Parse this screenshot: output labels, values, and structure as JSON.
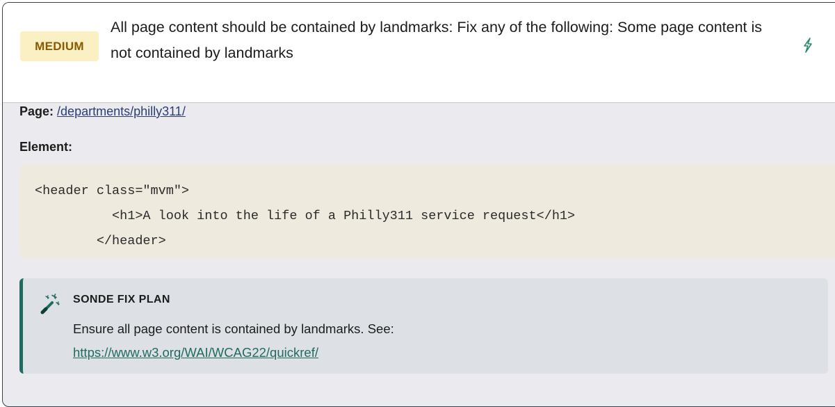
{
  "issue": {
    "severity": "MEDIUM",
    "title": "All page content should be contained by landmarks: Fix any of the following: Some page content is not contained by landmarks",
    "action_icon": "lightning-bolt-icon"
  },
  "details": {
    "page_label": "Page:",
    "page_link": "/departments/philly311/",
    "element_label": "Element:",
    "code_lines": [
      "<header class=\"mvm\">",
      "          <h1>A look into the life of a Philly311 service request</h1>",
      "        </header>"
    ]
  },
  "fix_plan": {
    "icon": "magic-wand-icon",
    "heading": "SONDE FIX PLAN",
    "text": "Ensure all page content is contained by landmarks. See:",
    "link": "https://www.w3.org/WAI/WCAG22/quickref/"
  },
  "colors": {
    "badge_bg": "#fbefc4",
    "badge_text": "#8a5a00",
    "accent": "#1e6b5f",
    "code_bg": "#efeade",
    "link": "#2b3d73"
  }
}
